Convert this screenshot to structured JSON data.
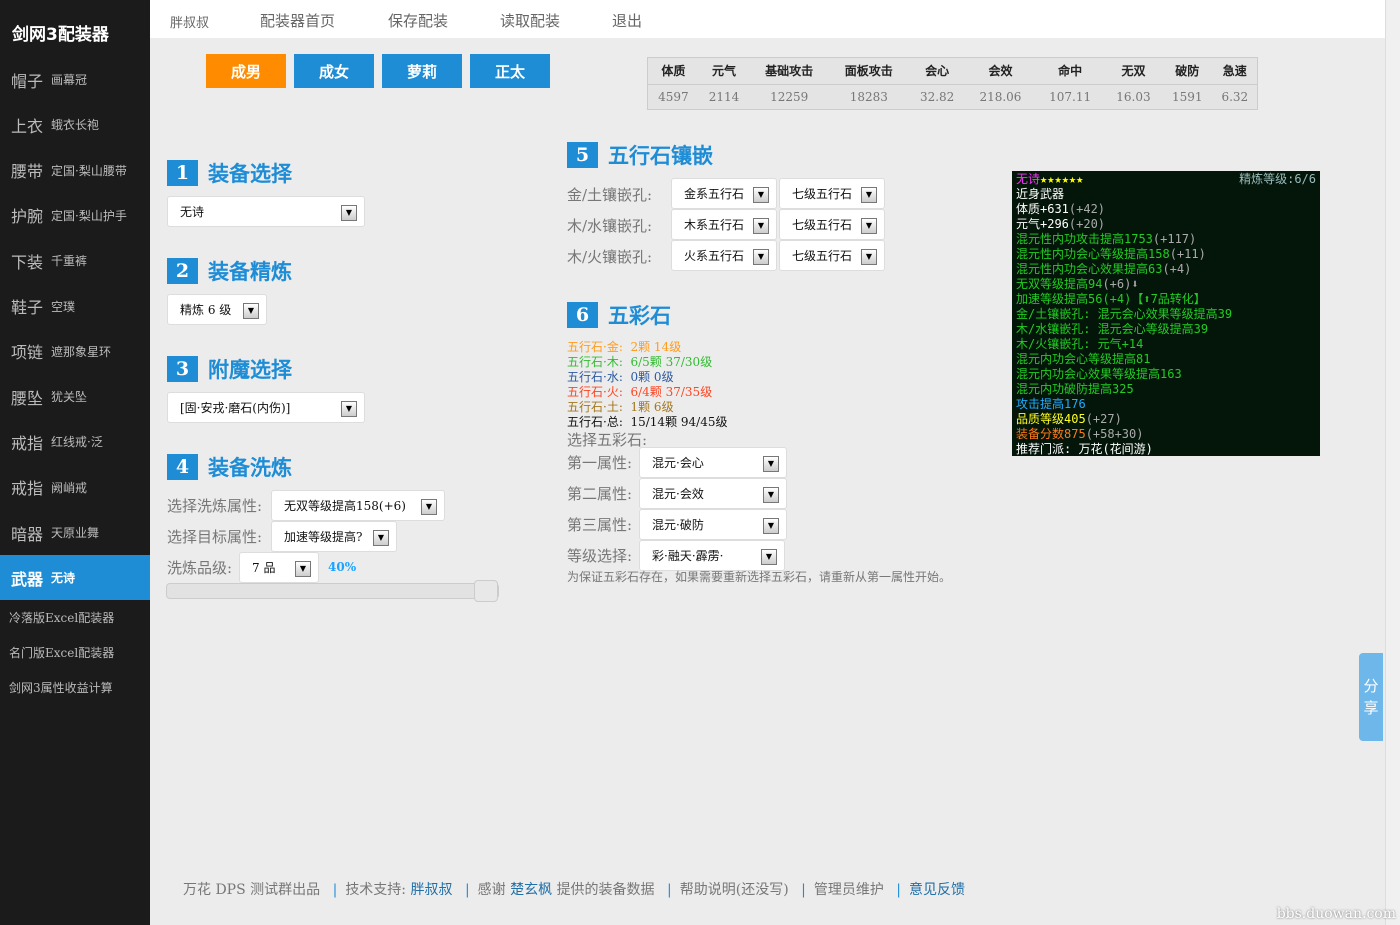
{
  "app": {
    "title": "剑网3配装器"
  },
  "nav": [
    "胖叔叔",
    "配装器首页",
    "保存配装",
    "读取配装",
    "退出"
  ],
  "sidebar": {
    "items": [
      {
        "slot": "帽子",
        "name": "画幕冠"
      },
      {
        "slot": "上衣",
        "name": "蛾衣长袍"
      },
      {
        "slot": "腰带",
        "name": "定国·梨山腰带"
      },
      {
        "slot": "护腕",
        "name": "定国·梨山护手"
      },
      {
        "slot": "下装",
        "name": "千重裤"
      },
      {
        "slot": "鞋子",
        "name": "空璞"
      },
      {
        "slot": "项链",
        "name": "遮那象星环"
      },
      {
        "slot": "腰坠",
        "name": "犹关坠"
      },
      {
        "slot": "戒指",
        "name": "红线戒·泛"
      },
      {
        "slot": "戒指",
        "name": "阙峭戒"
      },
      {
        "slot": "暗器",
        "name": "天原业舞"
      },
      {
        "slot": "武器",
        "name": "无诗"
      }
    ],
    "active_index": 11,
    "links": [
      "冷落版Excel配装器",
      "名门版Excel配装器",
      "剑网3属性收益计算"
    ]
  },
  "body_types": {
    "items": [
      "成男",
      "成女",
      "萝莉",
      "正太"
    ],
    "active": "成男",
    "active_color": "#ff8c00",
    "color": "#1f8dd6"
  },
  "stats": {
    "headers": [
      "体质",
      "元气",
      "基础攻击",
      "面板攻击",
      "会心",
      "会效",
      "命中",
      "无双",
      "破防",
      "急速"
    ],
    "values": [
      "4597",
      "2114",
      "12259",
      "18283",
      "32.82",
      "218.06",
      "107.11",
      "16.03",
      "1591",
      "6.32"
    ]
  },
  "sections": {
    "s1": {
      "num": "1",
      "title": "装备选择",
      "select": "无诗"
    },
    "s2": {
      "num": "2",
      "title": "装备精炼",
      "select": "精炼 6 级"
    },
    "s3": {
      "num": "3",
      "title": "附魔选择",
      "select": "[固·安戎·磨石(内伤)]"
    },
    "s4": {
      "num": "4",
      "title": "装备洗炼",
      "attr_label": "选择洗炼属性:",
      "attr_value": "无双等级提高158(+6)",
      "target_label": "选择目标属性:",
      "target_value": "加速等级提高?",
      "grade_label": "洗炼品级:",
      "grade_value": "7 品",
      "percent": "40%",
      "slider_fraction": 1.0
    },
    "s5": {
      "num": "5",
      "title": "五行石镶嵌",
      "rows": [
        {
          "label": "金/土镶嵌孔:",
          "type": "金系五行石",
          "level": "七级五行石"
        },
        {
          "label": "木/水镶嵌孔:",
          "type": "木系五行石",
          "level": "七级五行石"
        },
        {
          "label": "木/火镶嵌孔:",
          "type": "火系五行石",
          "level": "七级五行石"
        }
      ]
    },
    "s6": {
      "num": "6",
      "title": "五彩石",
      "stones": [
        {
          "text": "五行石·金:  2颗 14级",
          "color": "#ff9c1c"
        },
        {
          "text": "五行石·木:  6/5颗 37/30级",
          "color": "#33bb33"
        },
        {
          "text": "五行石·水:  0颗 0级",
          "color": "#2c5aa0"
        },
        {
          "text": "五行石·火:  6/4颗 37/35级",
          "color": "#ff4422"
        },
        {
          "text": "五行石·土:  1颗 6级",
          "color": "#a5761e"
        },
        {
          "text": "五行石·总:  15/14颗 94/45级",
          "color": "#111111"
        }
      ],
      "choose_label": "选择五彩石:",
      "attrs": [
        {
          "label": "第一属性:",
          "value": "混元·会心"
        },
        {
          "label": "第二属性:",
          "value": "混元·会效"
        },
        {
          "label": "第三属性:",
          "value": "混元·破防"
        },
        {
          "label": "等级选择:",
          "value": "彩·融天·霹雳·"
        }
      ],
      "note": "为保证五彩石存在，如果需要重新选择五彩石，请重新从第一属性开始。"
    }
  },
  "tooltip": {
    "name": "无诗",
    "stars": "★★★★★★",
    "refine": "精炼等级:6/6",
    "lines": [
      {
        "t": "近身武器",
        "c": "#ffffff"
      },
      {
        "t": "体质+631",
        "s": "(+42)",
        "c": "#ffffff"
      },
      {
        "t": "元气+296",
        "s": "(+20)",
        "c": "#ffffff"
      },
      {
        "t": "混元性内功攻击提高1753",
        "s": "(+117)",
        "c": "#22cc22"
      },
      {
        "t": "混元性内功会心等级提高158",
        "s": "(+11)",
        "c": "#22cc22"
      },
      {
        "t": "混元性内功会心效果提高63",
        "s": "(+4)",
        "c": "#22cc22"
      },
      {
        "t": "无双等级提高94",
        "s": "(+6)⬇",
        "c": "#22cc22"
      },
      {
        "t": "加速等级提高56(+4)【⬆7品转化】",
        "c": "#22cc22"
      },
      {
        "t": "金/土镶嵌孔: 混元会心效果等级提高39",
        "c": "#22cc22"
      },
      {
        "t": "木/水镶嵌孔: 混元会心等级提高39",
        "c": "#22cc22"
      },
      {
        "t": "木/火镶嵌孔: 元气+14",
        "c": "#22cc22"
      },
      {
        "t": "混元内功会心等级提高81",
        "c": "#22cc22"
      },
      {
        "t": "混元内功会心效果等级提高163",
        "c": "#22cc22"
      },
      {
        "t": "混元内功破防提高325",
        "c": "#22cc22"
      },
      {
        "t": "攻击提高176",
        "c": "#22aaff"
      },
      {
        "t": "品质等级405",
        "s": "(+27)",
        "c": "#ffff22"
      },
      {
        "t": "装备分数875",
        "s": "(+58+30)",
        "c": "#ff7a1a"
      },
      {
        "t": "推荐门派: 万花(花间游)",
        "c": "#ffffff"
      }
    ]
  },
  "footer": {
    "parts": [
      "万花 DPS 测试群出品",
      "技术支持:",
      "胖叔叔",
      "感谢",
      "楚玄枫",
      "提供的装备数据",
      "帮助说明(还没写)",
      "管理员维护",
      "意见反馈"
    ]
  },
  "share": "分享",
  "watermark": "bbs.duowan.com"
}
